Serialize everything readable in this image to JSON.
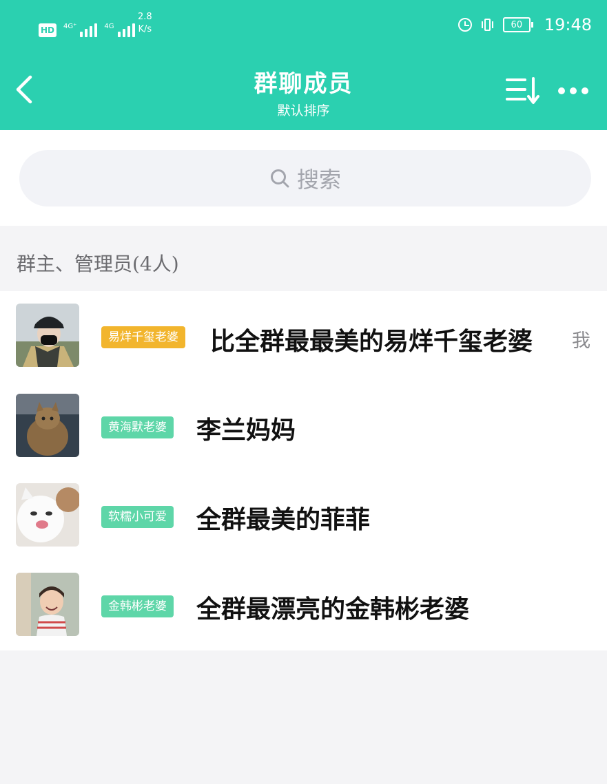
{
  "status_bar": {
    "hd": "HD",
    "net1": "4G⁺",
    "net2": "4G",
    "speed_value": "2.8",
    "speed_unit": "K/s",
    "battery": "60",
    "time": "19:48"
  },
  "header": {
    "title": "群聊成员",
    "subtitle": "默认排序",
    "icons": [
      "back-icon",
      "sort-icon",
      "more-icon"
    ]
  },
  "search": {
    "placeholder": "搜索"
  },
  "section": {
    "title": "群主、管理员(4人)"
  },
  "members": [
    {
      "badge": "易烊千玺老婆",
      "badge_color": "#f2b52d",
      "name": "比全群最最美的易烊千玺老婆",
      "self_tag": "我"
    },
    {
      "badge": "黄海默老婆",
      "badge_color": "#5ed6a8",
      "name": "李兰妈妈"
    },
    {
      "badge": "软糯小可爱",
      "badge_color": "#5ed6a8",
      "name": "全群最美的菲菲"
    },
    {
      "badge": "金韩彬老婆",
      "badge_color": "#5ed6a8",
      "name": "全群最漂亮的金韩彬老婆"
    }
  ],
  "colors": {
    "accent": "#2bd0b0",
    "owner_badge": "#f2b52d",
    "admin_badge": "#5ed6a8"
  }
}
